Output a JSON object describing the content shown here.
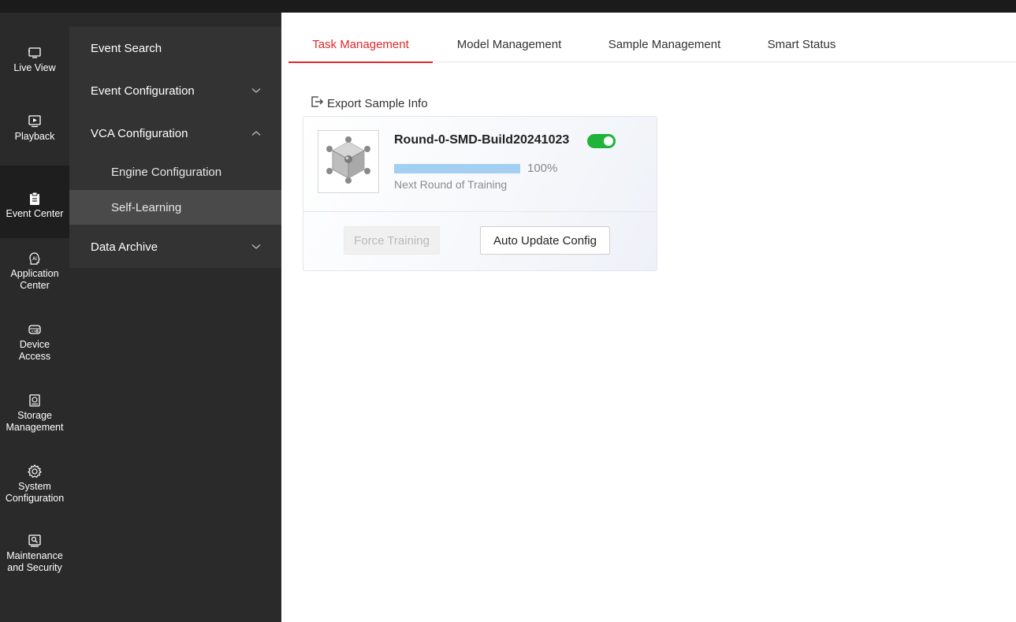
{
  "rail": {
    "items": [
      {
        "label": "Live View",
        "icon": "monitor-icon"
      },
      {
        "label": "Playback",
        "icon": "playback-icon"
      },
      {
        "label": "Event Center",
        "icon": "clipboard-icon",
        "active": true
      },
      {
        "label": "Application\nCenter",
        "icon": "ai-icon"
      },
      {
        "label": "Device\nAccess",
        "icon": "device-icon"
      },
      {
        "label": "Storage\nManagement",
        "icon": "storage-icon"
      },
      {
        "label": "System\nConfiguration",
        "icon": "gear-icon"
      },
      {
        "label": "Maintenance\nand Security",
        "icon": "maintenance-icon"
      }
    ]
  },
  "submenu": {
    "event_search": "Event Search",
    "event_configuration": "Event Configuration",
    "vca_configuration": "VCA Configuration",
    "engine_configuration": "Engine Configuration",
    "self_learning": "Self-Learning",
    "data_archive": "Data Archive"
  },
  "tabs": {
    "task_management": "Task Management",
    "model_management": "Model Management",
    "sample_management": "Sample Management",
    "smart_status": "Smart Status"
  },
  "export_label": "Export Sample Info",
  "task": {
    "name": "Round-0-SMD-Build20241023",
    "enabled": true,
    "progress_percent": 100,
    "progress_label": "100%",
    "caption": "Next Round of Training",
    "force_training_label": "Force Training",
    "auto_update_label": "Auto Update Config"
  },
  "colors": {
    "accent": "#e0282b",
    "toggle_on": "#1fb33a",
    "progress_fill": "#a3cff2"
  }
}
